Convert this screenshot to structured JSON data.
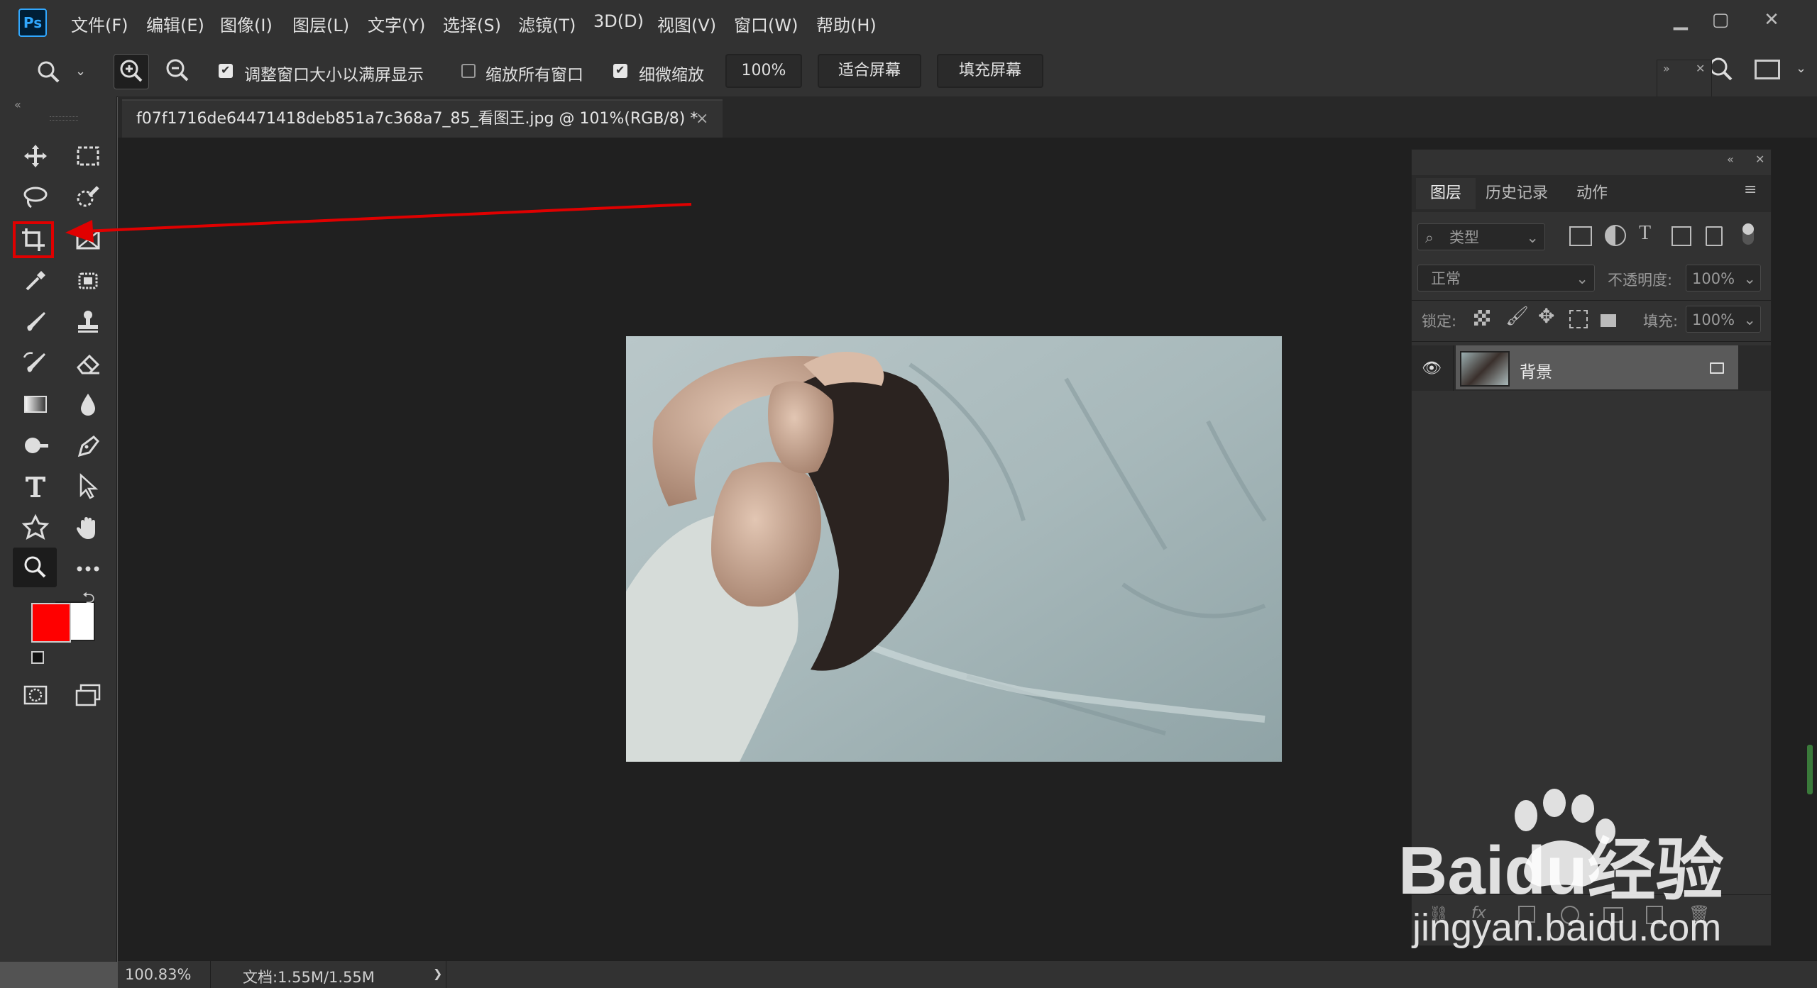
{
  "app": {
    "logo": "Ps"
  },
  "menu": [
    "文件(F)",
    "编辑(E)",
    "图像(I)",
    "图层(L)",
    "文字(Y)",
    "选择(S)",
    "滤镜(T)",
    "3D(D)",
    "视图(V)",
    "窗口(W)",
    "帮助(H)"
  ],
  "options": {
    "resize_windows": "调整窗口大小以满屏显示",
    "zoom_all": "缩放所有窗口",
    "scrubby_zoom": "细微缩放",
    "zoom_value": "100%",
    "fit_screen": "适合屏幕",
    "fill_screen": "填充屏幕"
  },
  "document": {
    "tab_title": "f07f1716de64471418deb851a7c368a7_85_看图王.jpg @ 101%(RGB/8) *",
    "close": "×"
  },
  "layers_panel": {
    "tabs": [
      "图层",
      "历史记录",
      "动作"
    ],
    "filter_placeholder": "类型",
    "blend_mode": "正常",
    "opacity_label": "不透明度:",
    "opacity_value": "100%",
    "lock_label": "锁定:",
    "fill_label": "填充:",
    "fill_value": "100%",
    "layer_name": "背景"
  },
  "status": {
    "zoom": "100.83%",
    "doc": "文档:1.55M/1.55M",
    "arrow": "❯"
  },
  "colors": {
    "foreground": "#ff0000",
    "background": "#ffffff",
    "accent": "#31a8ff",
    "annotation": "#e00000"
  },
  "watermark": {
    "brand": "Baidu经验",
    "url": "jingyan.baidu.com"
  }
}
